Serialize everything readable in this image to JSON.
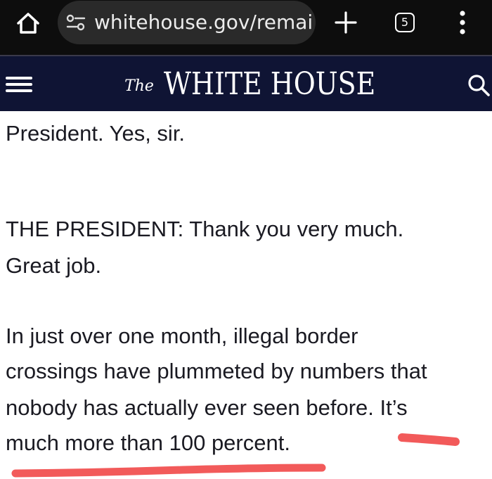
{
  "browser": {
    "url_text": "whitehouse.gov/remai",
    "tab_count": "5",
    "icons": {
      "home": "home-icon",
      "site_info": "tune-icon",
      "new_tab": "plus-icon",
      "tabs": "tab-switcher-icon",
      "menu": "kebab-menu-icon"
    }
  },
  "site_header": {
    "logo_the": "The",
    "logo_main": "WHITE HOUSE",
    "icons": {
      "menu": "hamburger-icon",
      "search": "search-icon"
    },
    "background": "#0f1434"
  },
  "article": {
    "lines": [
      "President.  Yes, sir.",
      "   THE PRESIDENT:  Thank you very much.",
      "Great job.",
      "   In just over one month, illegal border",
      "crossings have plummeted by numbers that",
      "nobody has actually ever seen before.  It’s",
      "much more than 100 percent."
    ]
  },
  "annotation": {
    "color": "#f25a5a",
    "type": "red-underline-marks"
  }
}
